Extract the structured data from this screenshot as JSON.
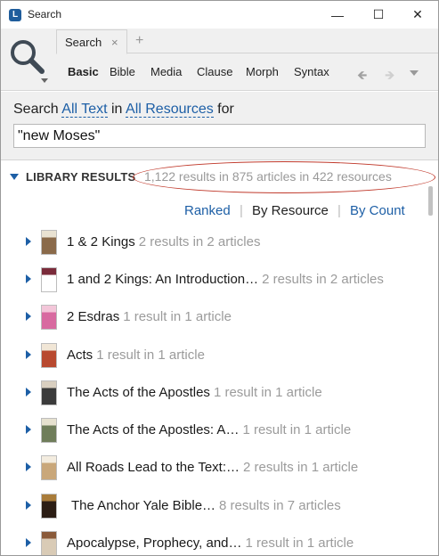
{
  "window": {
    "title": "Search",
    "app_icon_glyph": "L",
    "minimize_glyph": "—",
    "maximize_glyph": "☐",
    "close_glyph": "✕"
  },
  "toolbar": {
    "tool_icon": "magnifier-icon",
    "tabs": [
      {
        "label": "Search",
        "close_glyph": "×"
      }
    ],
    "add_tab_glyph": "+",
    "modes": [
      "Basic",
      "Bible",
      "Media",
      "Clause",
      "Morph",
      "Syntax"
    ],
    "active_mode": "Basic",
    "back_glyph": "🡸",
    "forward_glyph": "🡺"
  },
  "query": {
    "prefix": "Search",
    "scope": "All Text",
    "in_word": "in",
    "resources": "All Resources",
    "for_word": "for",
    "value": "\"new Moses\""
  },
  "library": {
    "title": "LIBRARY RESULTS",
    "summary": "1,122 results in 875 articles in 422 resources",
    "sort": {
      "ranked": "Ranked",
      "by_resource": "By Resource",
      "by_count": "By Count",
      "separator": "|"
    },
    "results": [
      {
        "name": "1 & 2 Kings",
        "meta": "2 results in 2 articles",
        "cover_color": "#8a6a4a",
        "cover_accent": "#e9e2d2"
      },
      {
        "name": "1 and 2 Kings: An Introduction…",
        "meta": "2 results in 2 articles",
        "cover_color": "#ffffff",
        "cover_accent": "#7a2b3a"
      },
      {
        "name": "2 Esdras",
        "meta": "1 result in 1 article",
        "cover_color": "#d86aa0",
        "cover_accent": "#f3c6d9"
      },
      {
        "name": "Acts",
        "meta": "1 result in 1 article",
        "cover_color": "#b8492f",
        "cover_accent": "#f1e6d6"
      },
      {
        "name": "The Acts of the Apostles",
        "meta": "1 result in 1 article",
        "cover_color": "#3b3b3b",
        "cover_accent": "#d9cfc0"
      },
      {
        "name": "The Acts of the Apostles: A…",
        "meta": "1 result in 1 article",
        "cover_color": "#6f7d5a",
        "cover_accent": "#e6e1cf"
      },
      {
        "name": "All Roads Lead to the Text:…",
        "meta": "2 results in 1 article",
        "cover_color": "#c9a77a",
        "cover_accent": "#f3ecdf"
      },
      {
        "name": "The Anchor Yale Bible…",
        "meta": "8 results in 7 articles",
        "cover_color": "#2b1d14",
        "cover_accent": "#a97c3a"
      },
      {
        "name": "Apocalypse, Prophecy, and…",
        "meta": "1 result in 1 article",
        "cover_color": "#d9cbb6",
        "cover_accent": "#8a5a3a"
      }
    ]
  }
}
